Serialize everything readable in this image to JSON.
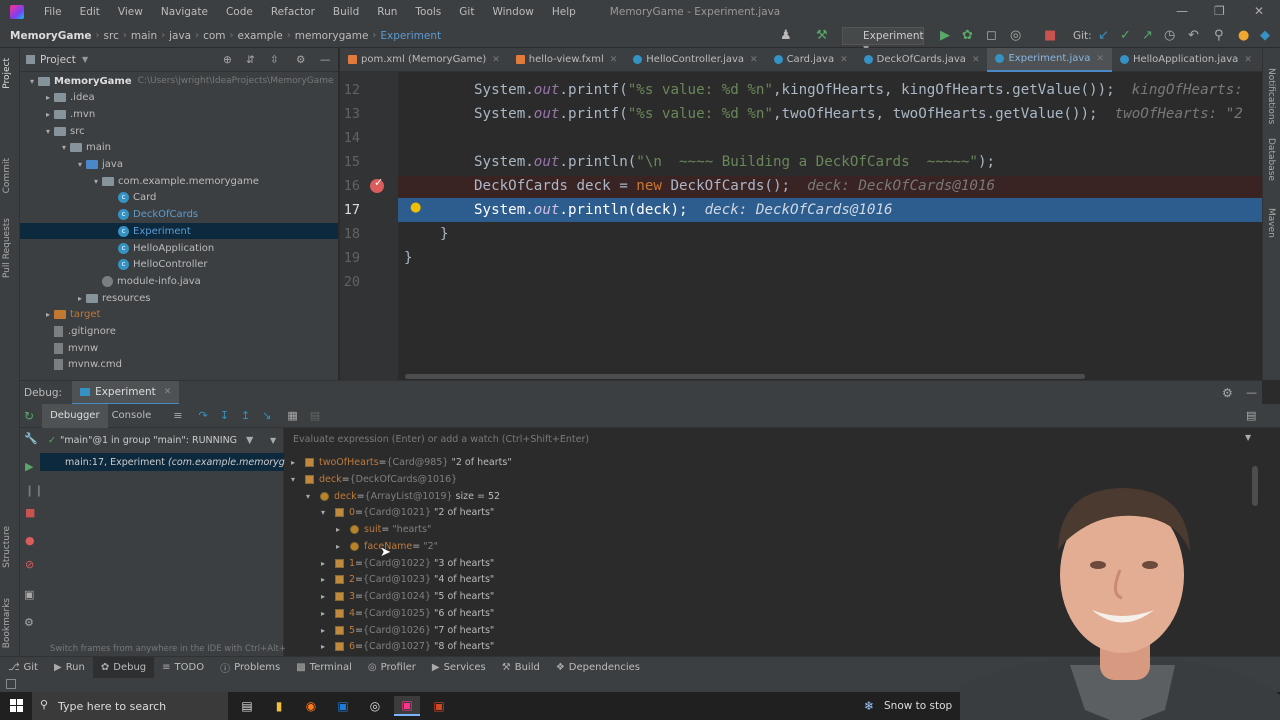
{
  "titlebar": {
    "menus": [
      "File",
      "Edit",
      "View",
      "Navigate",
      "Code",
      "Refactor",
      "Build",
      "Run",
      "Tools",
      "Git",
      "Window",
      "Help"
    ],
    "title": "MemoryGame - Experiment.java"
  },
  "navbar": {
    "breadcrumbs": [
      "MemoryGame",
      "src",
      "main",
      "java",
      "com",
      "example",
      "memorygame",
      "Experiment"
    ],
    "run_config": "Experiment",
    "git_label": "Git:"
  },
  "project_panel": {
    "title": "Project",
    "tree": [
      {
        "label": "MemoryGame",
        "path": "C:\\Users\\jwright\\IdeaProjects\\MemoryGame",
        "kind": "folder",
        "depth": 0,
        "expanded": true
      },
      {
        "label": ".idea",
        "kind": "folder",
        "depth": 1
      },
      {
        "label": ".mvn",
        "kind": "folder",
        "depth": 1
      },
      {
        "label": "src",
        "kind": "folder",
        "depth": 1,
        "expanded": true
      },
      {
        "label": "main",
        "kind": "folder",
        "depth": 2,
        "expanded": true
      },
      {
        "label": "java",
        "kind": "folder-blue",
        "depth": 3,
        "expanded": true
      },
      {
        "label": "com.example.memorygame",
        "kind": "folder",
        "depth": 4,
        "expanded": true
      },
      {
        "label": "Card",
        "kind": "class",
        "depth": 5
      },
      {
        "label": "DeckOfCards",
        "kind": "class",
        "depth": 5
      },
      {
        "label": "Experiment",
        "kind": "class",
        "depth": 5,
        "selected": true
      },
      {
        "label": "HelloApplication",
        "kind": "class",
        "depth": 5
      },
      {
        "label": "HelloController",
        "kind": "class",
        "depth": 5
      },
      {
        "label": "module-info.java",
        "kind": "java",
        "depth": 4
      },
      {
        "label": "resources",
        "kind": "folder",
        "depth": 3
      },
      {
        "label": "target",
        "kind": "folder-orange",
        "depth": 1
      },
      {
        "label": ".gitignore",
        "kind": "file",
        "depth": 1
      },
      {
        "label": "mvnw",
        "kind": "file",
        "depth": 1
      },
      {
        "label": "mvnw.cmd",
        "kind": "file",
        "depth": 1
      }
    ]
  },
  "editor": {
    "tabs": [
      {
        "label": "pom.xml (MemoryGame)",
        "type": "xml"
      },
      {
        "label": "hello-view.fxml",
        "type": "xml"
      },
      {
        "label": "HelloController.java",
        "type": "java"
      },
      {
        "label": "Card.java",
        "type": "java"
      },
      {
        "label": "DeckOfCards.java",
        "type": "java"
      },
      {
        "label": "Experiment.java",
        "type": "java",
        "active": true
      },
      {
        "label": "HelloApplication.java",
        "type": "java"
      }
    ],
    "line_numbers": [
      "12",
      "13",
      "14",
      "15",
      "16",
      "17",
      "18",
      "19",
      "20"
    ],
    "lines": {
      "l12_a": "System.",
      "l12_out": "out",
      "l12_b": ".printf(",
      "l12_str": "\"%s value: %d %n\"",
      "l12_c": ",kingOfHearts, kingOfHearts.getValue());",
      "l12_hint": "kingOfHearts:",
      "l13_a": "System.",
      "l13_out": "out",
      "l13_b": ".printf(",
      "l13_str": "\"%s value: %d %n\"",
      "l13_c": ",twoOfHearts, twoOfHearts.getValue());",
      "l13_hint": "twoOfHearts: \"2",
      "l15_a": "System.",
      "l15_out": "out",
      "l15_b": ".println(",
      "l15_str": "\"\\n  ~~~~ Building a DeckOfCards  ~~~~~\"",
      "l15_c": ");",
      "l16_a": "DeckOfCards deck = ",
      "l16_new": "new",
      "l16_b": " DeckOfCards();",
      "l16_hint": "deck: DeckOfCards@1016",
      "l17_a": "System.",
      "l17_out": "out",
      "l17_b": ".println(deck);",
      "l17_hint": "deck: DeckOfCards@1016",
      "l18": "}",
      "l19": "}"
    }
  },
  "debug": {
    "label": "Debug:",
    "session_tab": "Experiment",
    "tabs": [
      "Debugger",
      "Console"
    ],
    "thread": "\"main\"@1 in group \"main\": RUNNING",
    "frame_location": "main:17, Experiment",
    "frame_package": "(com.example.memorygame)",
    "frames_hint": "Switch frames from anywhere in the IDE with Ctrl+Alt+...",
    "eval_placeholder": "Evaluate expression (Enter) or add a watch (Ctrl+Shift+Enter)",
    "variables": [
      {
        "name": "twoOfHearts",
        "type": "{Card@985}",
        "value": "\"2 of hearts\"",
        "depth": 0,
        "expanded": false,
        "icon": "field"
      },
      {
        "name": "deck",
        "type": "{DeckOfCards@1016}",
        "value": "",
        "depth": 0,
        "expanded": true,
        "icon": "field"
      },
      {
        "name": "deck",
        "type": "{ArrayList@1019}",
        "value": "size = 52",
        "depth": 1,
        "expanded": true,
        "icon": "private"
      },
      {
        "name": "0",
        "type": "{Card@1021}",
        "value": "\"2 of hearts\"",
        "depth": 2,
        "expanded": true,
        "icon": "field"
      },
      {
        "name": "suit",
        "type": "",
        "value": "\"hearts\"",
        "depth": 3,
        "expanded": false,
        "icon": "private"
      },
      {
        "name": "faceName",
        "type": "",
        "value": "\"2\"",
        "depth": 3,
        "expanded": false,
        "icon": "private"
      },
      {
        "name": "1",
        "type": "{Card@1022}",
        "value": "\"3 of hearts\"",
        "depth": 2,
        "expanded": false,
        "icon": "field"
      },
      {
        "name": "2",
        "type": "{Card@1023}",
        "value": "\"4 of hearts\"",
        "depth": 2,
        "expanded": false,
        "icon": "field"
      },
      {
        "name": "3",
        "type": "{Card@1024}",
        "value": "\"5 of hearts\"",
        "depth": 2,
        "expanded": false,
        "icon": "field"
      },
      {
        "name": "4",
        "type": "{Card@1025}",
        "value": "\"6 of hearts\"",
        "depth": 2,
        "expanded": false,
        "icon": "field"
      },
      {
        "name": "5",
        "type": "{Card@1026}",
        "value": "\"7 of hearts\"",
        "depth": 2,
        "expanded": false,
        "icon": "field"
      },
      {
        "name": "6",
        "type": "{Card@1027}",
        "value": "\"8 of hearts\"",
        "depth": 2,
        "expanded": false,
        "icon": "field"
      }
    ]
  },
  "bottom_tabs": [
    "Git",
    "Run",
    "Debug",
    "TODO",
    "Problems",
    "Terminal",
    "Profiler",
    "Services",
    "Build",
    "Dependencies"
  ],
  "taskbar": {
    "search_placeholder": "Type here to search",
    "weather_text": "Snow to stop"
  },
  "colors": {
    "accent": "#4a88c7",
    "execution_line": "#2d5c8f",
    "breakpoint_line": "#3a2323",
    "breakpoint": "#db5c5c"
  }
}
